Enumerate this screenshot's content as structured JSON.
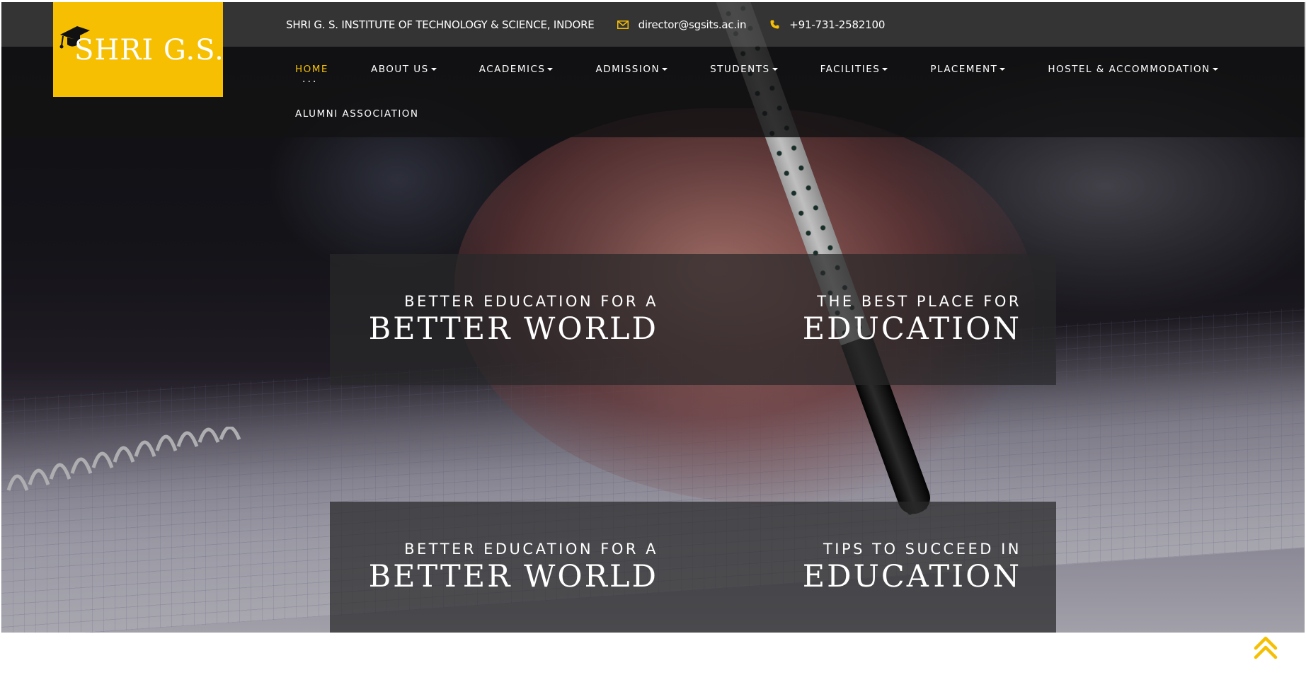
{
  "topbar": {
    "institute": "SHRI G. S. INSTITUTE OF TECHNOLOGY & SCIENCE, INDORE",
    "email": "director@sgsits.ac.in",
    "phone": "+91-731-2582100",
    "email_icon": "envelope-icon",
    "phone_icon": "phone-icon"
  },
  "logo": {
    "text": "SHRI G.S.",
    "icon": "graduation-cap-icon",
    "background": "#f6bf02"
  },
  "nav": {
    "items": [
      {
        "label": "HOME",
        "active": true,
        "dropdown": false
      },
      {
        "label": "ABOUT US",
        "dropdown": true
      },
      {
        "label": "ACADEMICS",
        "dropdown": true
      },
      {
        "label": "ADMISSION",
        "dropdown": true
      },
      {
        "label": "STUDENTS",
        "dropdown": true
      },
      {
        "label": "FACILITIES",
        "dropdown": true
      },
      {
        "label": "PLACEMENT",
        "dropdown": true
      },
      {
        "label": "HOSTEL & ACCOMMODATION",
        "dropdown": true
      },
      {
        "label": "ALUMNI ASSOCIATION",
        "dropdown": false
      }
    ],
    "active_dots": "...",
    "accent": "#f6bf02"
  },
  "slides": [
    {
      "left_small": "BETTER EDUCATION FOR A",
      "left_big": "BETTER WORLD",
      "right_small": "THE BEST PLACE FOR",
      "right_big": "EDUCATION"
    },
    {
      "left_small": "BETTER EDUCATION FOR A",
      "left_big": "BETTER WORLD",
      "right_small": "TIPS TO SUCCEED IN",
      "right_big": "EDUCATION"
    }
  ],
  "scroll_top": {
    "icon": "double-chevron-up-icon",
    "color": "#f6bf02"
  }
}
